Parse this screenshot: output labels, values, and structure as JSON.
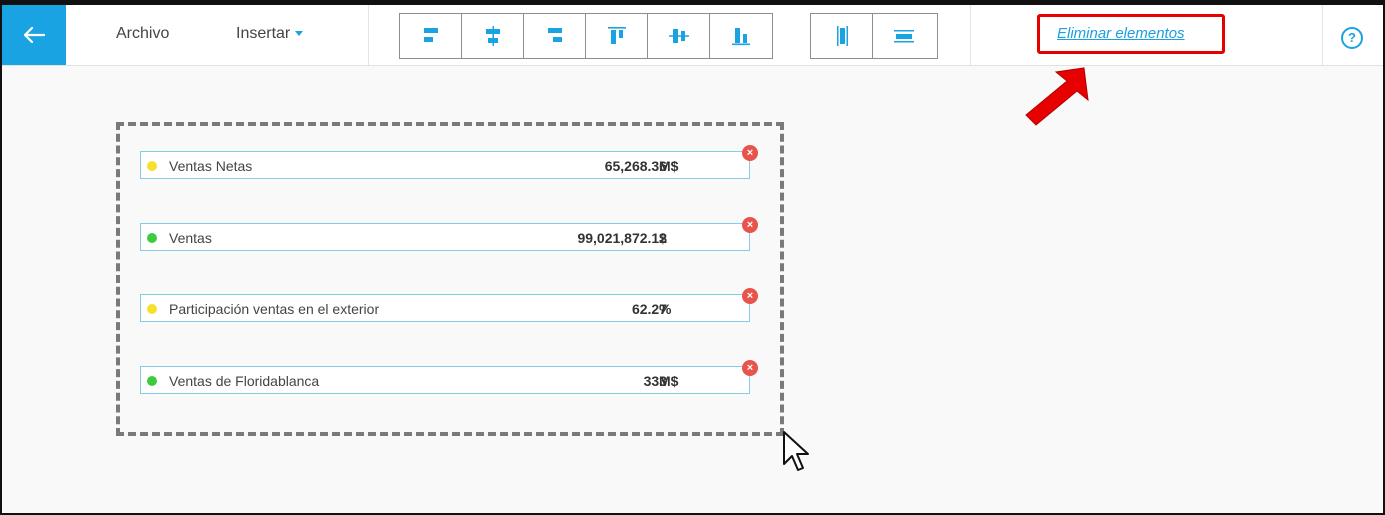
{
  "header": {
    "back_label": "back",
    "menu": [
      {
        "label": "Archivo"
      },
      {
        "label": "Insertar"
      }
    ],
    "delete_label": "Eliminar elementos",
    "help_label": "?"
  },
  "toolbar": {
    "align_group": [
      "align-left-icon",
      "align-center-horizontal-icon",
      "align-right-icon",
      "align-top-icon",
      "align-center-vertical-icon",
      "align-bottom-icon"
    ],
    "distribute_group": [
      "distribute-horizontal-icon",
      "distribute-vertical-icon"
    ]
  },
  "cards": [
    {
      "label": "Ventas Netas",
      "value": "65,268.36",
      "unit": "M$",
      "dot_color": "#f5e02e"
    },
    {
      "label": "Ventas",
      "value": "99,021,872.12",
      "unit": "$",
      "dot_color": "#3ecc3e"
    },
    {
      "label": "Participación ventas en el exterior",
      "value": "62.27",
      "unit": "%",
      "dot_color": "#f5e02e"
    },
    {
      "label": "Ventas de Floridablanca",
      "value": "333",
      "unit": "M$",
      "dot_color": "#3ecc3e"
    }
  ],
  "close_glyph": "×",
  "colors": {
    "accent": "#1aa3e3",
    "highlight": "#e60000"
  }
}
